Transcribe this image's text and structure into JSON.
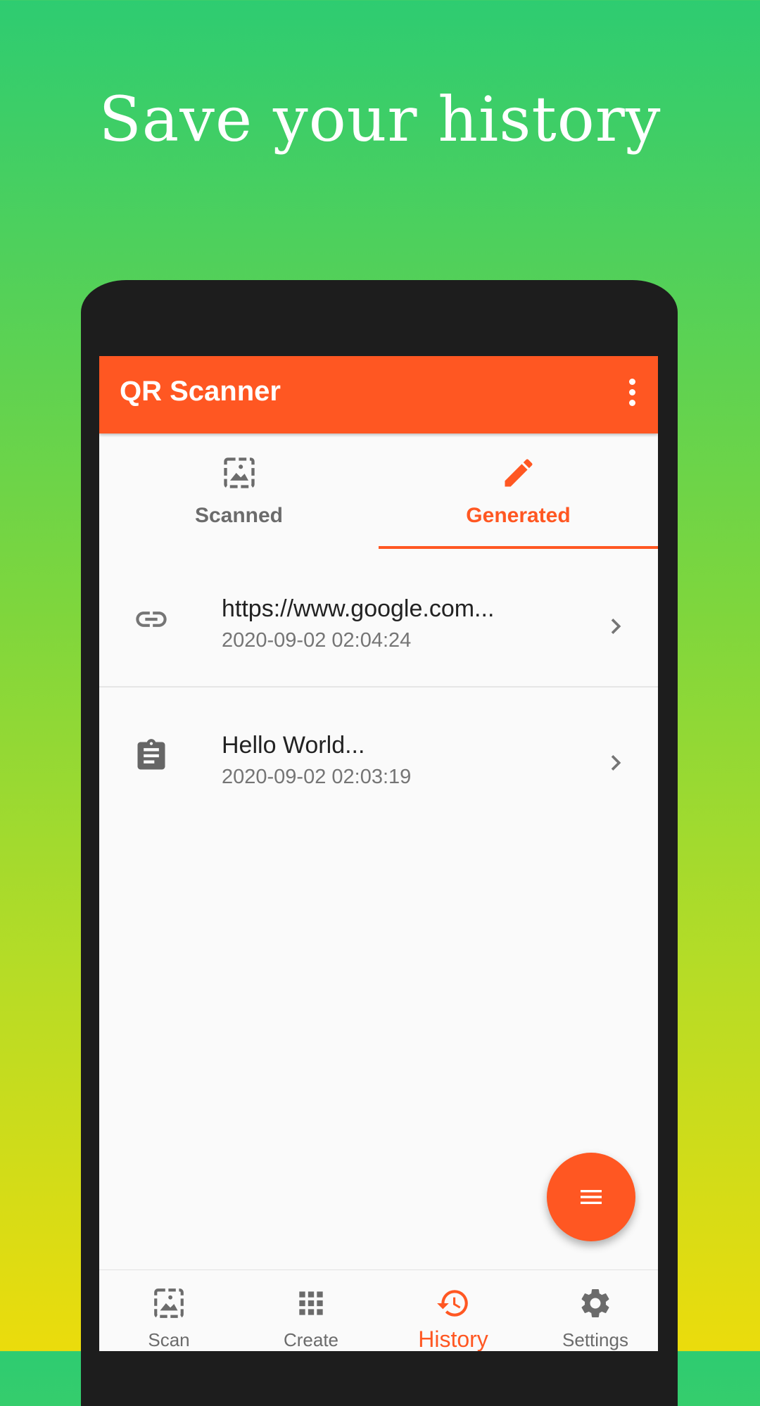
{
  "headline": "Save your history",
  "app": {
    "title": "QR Scanner",
    "accent_color": "#ff5722",
    "menu_icon": "more-vert-icon"
  },
  "tabs": [
    {
      "label": "Scanned",
      "icon": "image-icon",
      "active": false
    },
    {
      "label": "Generated",
      "icon": "pencil-icon",
      "active": true
    }
  ],
  "history": [
    {
      "title": "https://www.google.com...",
      "date": "2020-09-02 02:04:24",
      "icon": "link-icon"
    },
    {
      "title": "Hello World...",
      "date": "2020-09-02 02:03:19",
      "icon": "clipboard-text-icon"
    }
  ],
  "fab": {
    "icon": "menu-lines-icon"
  },
  "bottom_nav": [
    {
      "label": "Scan",
      "icon": "image-icon",
      "active": false
    },
    {
      "label": "Create",
      "icon": "grid-icon",
      "active": false
    },
    {
      "label": "History",
      "icon": "history-icon",
      "active": true
    },
    {
      "label": "Settings",
      "icon": "gear-icon",
      "active": false
    }
  ]
}
